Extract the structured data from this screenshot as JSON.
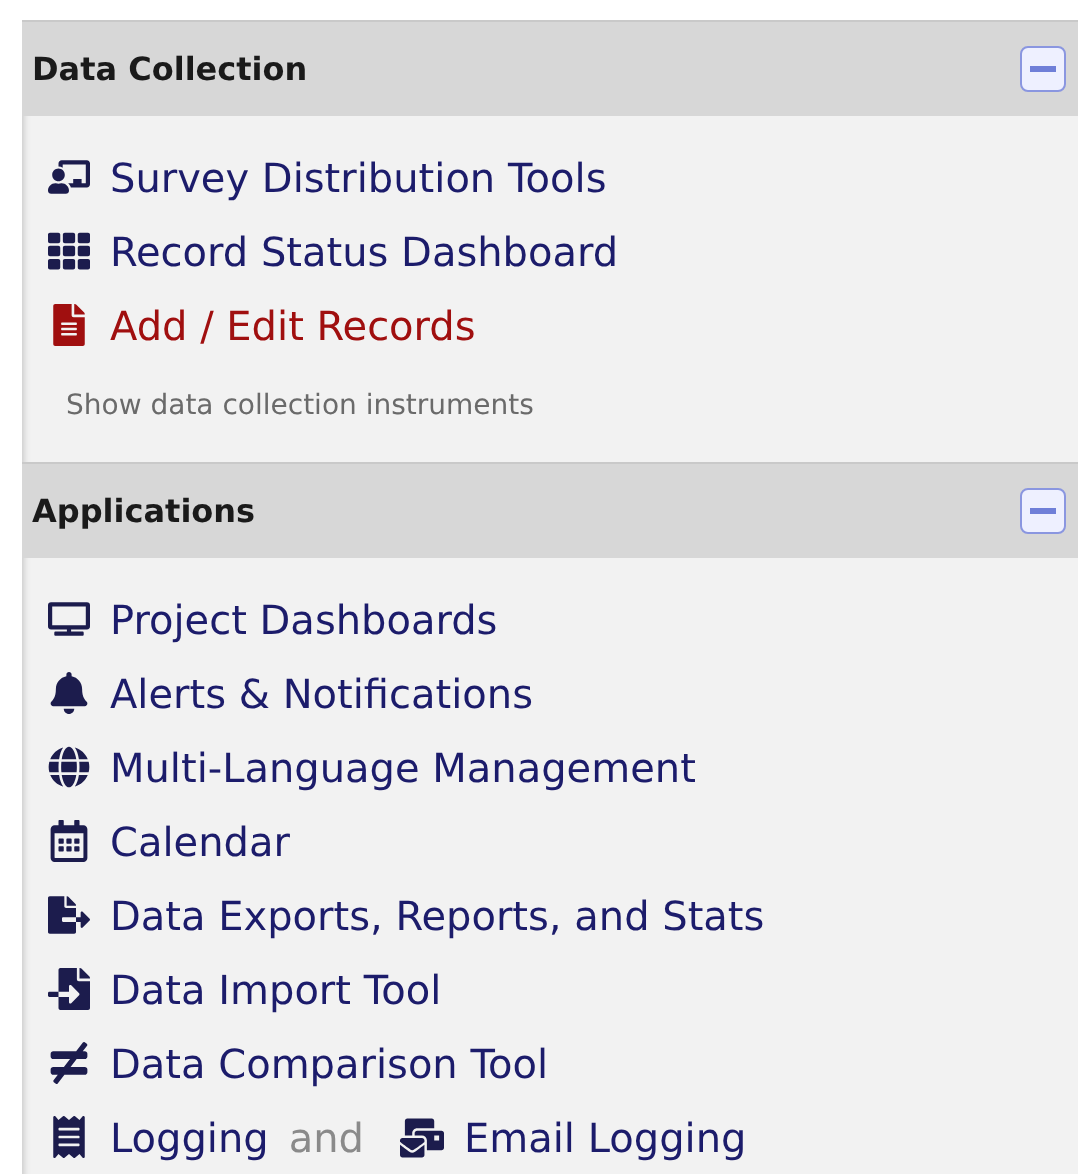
{
  "sections": [
    {
      "title": "Data Collection",
      "expanded": true,
      "items": [
        {
          "kind": "link",
          "label": "Survey Distribution Tools",
          "selected": false
        },
        {
          "kind": "link",
          "label": "Record Status Dashboard",
          "selected": false
        },
        {
          "kind": "link",
          "label": "Add / Edit Records",
          "selected": true
        },
        {
          "kind": "note",
          "label": "Show data collection instruments"
        }
      ]
    },
    {
      "title": "Applications",
      "expanded": true,
      "items": [
        {
          "kind": "link",
          "label": "Project Dashboards",
          "selected": false
        },
        {
          "kind": "link",
          "label": "Alerts & Notifications",
          "selected": false
        },
        {
          "kind": "link",
          "label": "Multi-Language Management",
          "selected": false
        },
        {
          "kind": "link",
          "label": "Calendar",
          "selected": false
        },
        {
          "kind": "link",
          "label": "Data Exports, Reports, and Stats",
          "selected": false
        },
        {
          "kind": "link",
          "label": "Data Import Tool",
          "selected": false
        },
        {
          "kind": "link",
          "label": "Data Comparison Tool",
          "selected": false
        },
        {
          "kind": "pair",
          "label": "Logging",
          "joiner": "and",
          "second_label": "Email Logging",
          "selected": false
        }
      ]
    }
  ]
}
